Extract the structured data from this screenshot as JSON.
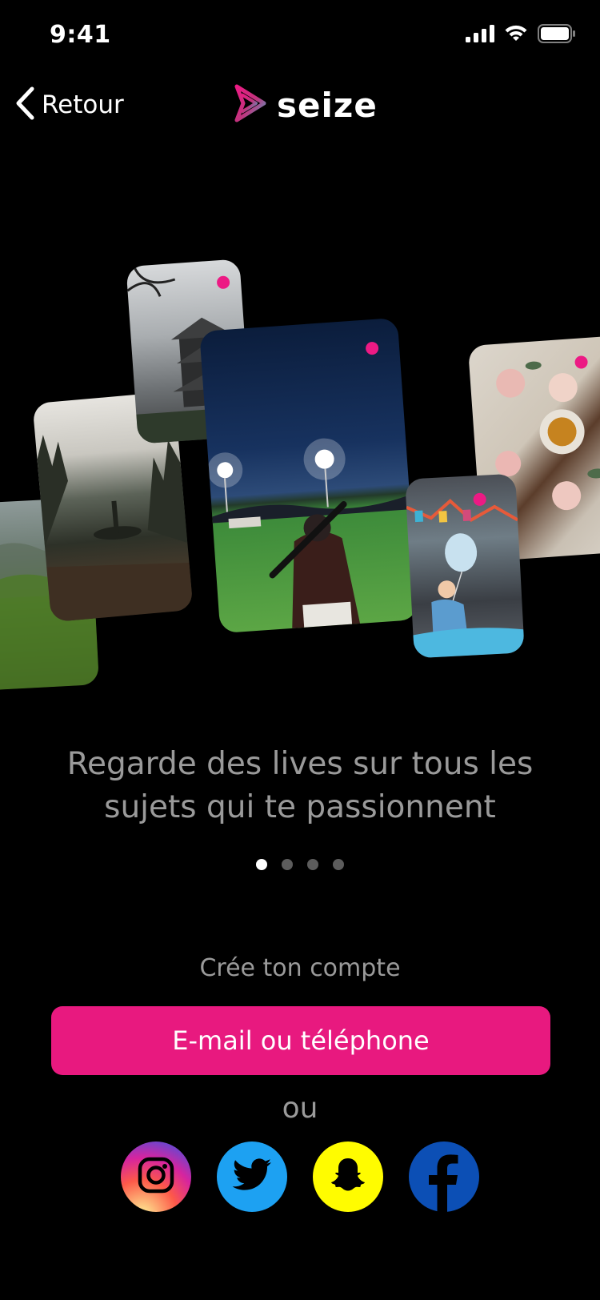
{
  "status_bar": {
    "time": "9:41"
  },
  "nav": {
    "back_label": "Retour",
    "brand": "seize"
  },
  "collage": {
    "cards": [
      {
        "subject": "mountain landscape"
      },
      {
        "subject": "misty forest lake"
      },
      {
        "subject": "japanese castle"
      },
      {
        "subject": "baseball player at night"
      },
      {
        "subject": "child with balloon"
      },
      {
        "subject": "roses and tea"
      }
    ]
  },
  "headline": {
    "line1": "Regarde des lives sur tous les",
    "line2": "sujets qui te passionnent"
  },
  "pagination": {
    "current": 1,
    "total": 4
  },
  "signup": {
    "label": "Crée ton compte",
    "email_button": "E-mail ou téléphone",
    "or_label": "ou",
    "socials": [
      "instagram-icon",
      "twitter-icon",
      "snapchat-icon",
      "facebook-icon"
    ]
  },
  "colors": {
    "accent": "#e8197f",
    "live_dot": "#ec1a84",
    "muted_text": "#9a9a9a"
  }
}
